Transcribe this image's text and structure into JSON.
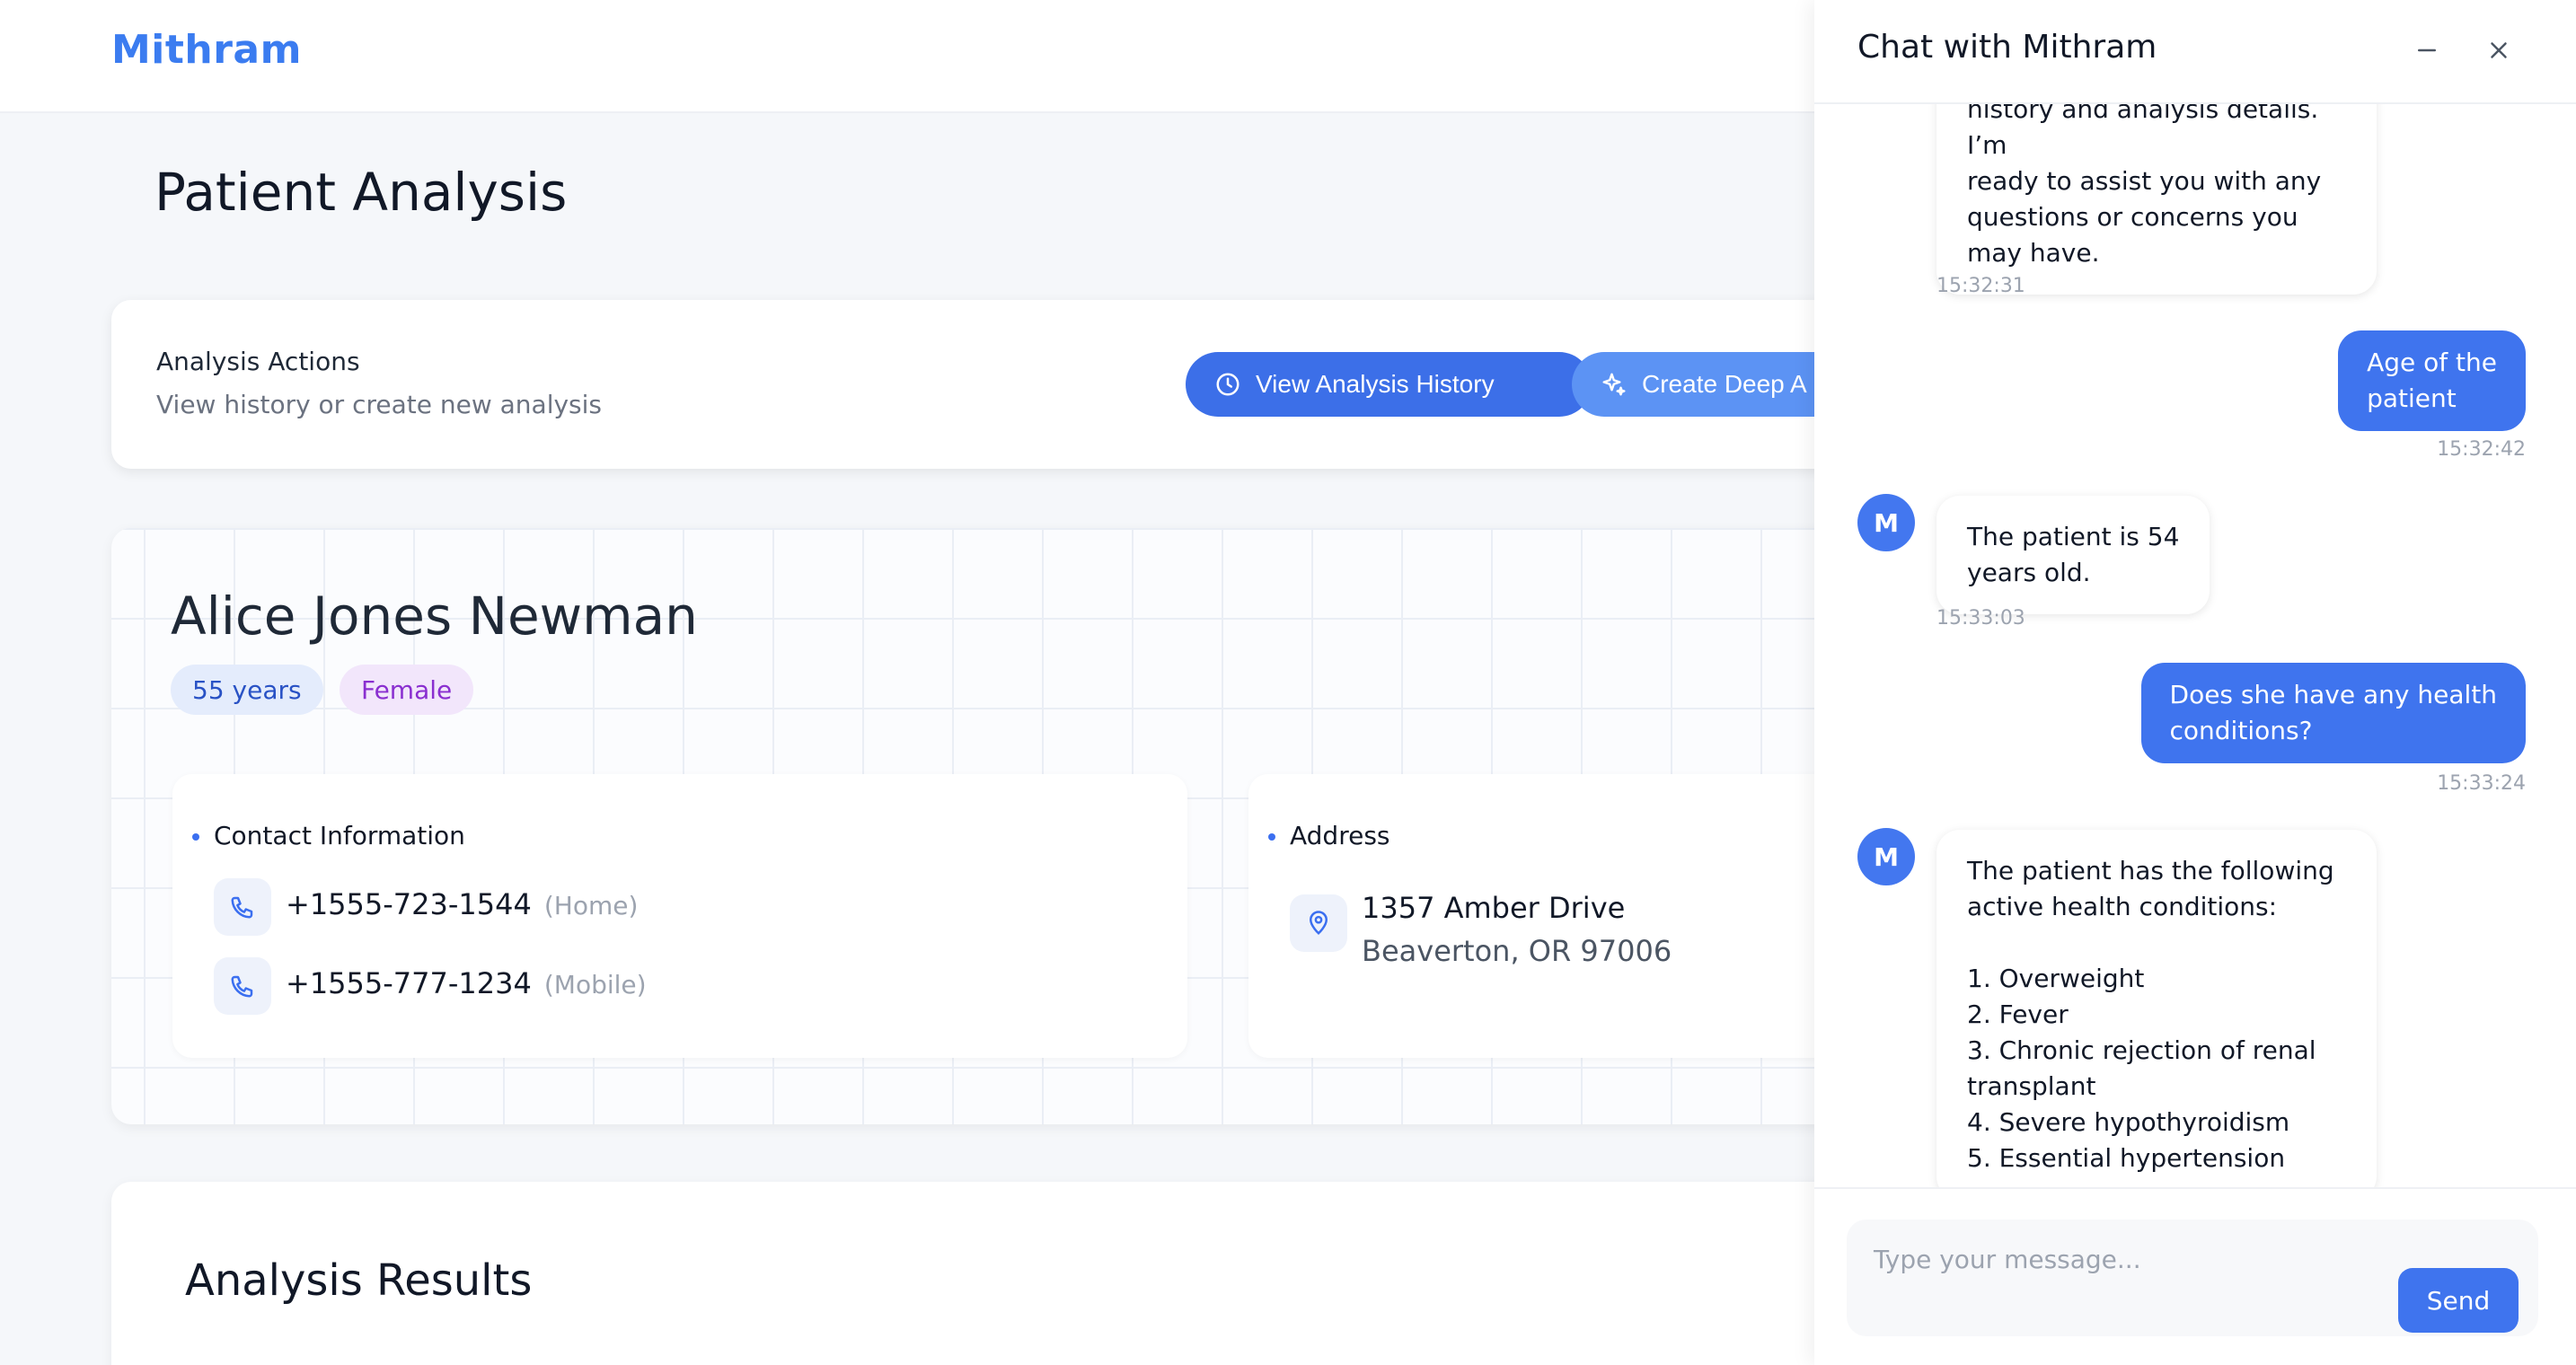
{
  "app": {
    "logo": "Mithram"
  },
  "page": {
    "title": "Patient Analysis"
  },
  "actions": {
    "title": "Analysis Actions",
    "subtitle": "View history or create new analysis",
    "history_label": "View Analysis History",
    "deep_label": "Create Deep A"
  },
  "patient": {
    "name": "Alice Jones Newman",
    "age": "55 years",
    "gender": "Female",
    "contact": {
      "title": "Contact Information",
      "phones": [
        {
          "number": "+1555-723-1544",
          "type": "(Home)"
        },
        {
          "number": "+1555-777-1234",
          "type": "(Mobile)"
        }
      ]
    },
    "address": {
      "title": "Address",
      "line1": "1357 Amber Drive",
      "line2": "Beaverton, OR 97006"
    }
  },
  "results": {
    "title": "Analysis Results"
  },
  "chat": {
    "title": "Chat with Mithram",
    "avatar_letter": "M",
    "messages": [
      {
        "role": "bot",
        "text": "history and analysis details. I’m\nready to assist you with any\nquestions or concerns you\nmay have.",
        "time": "15:32:31"
      },
      {
        "role": "user",
        "text": "Age of the\npatient",
        "time": "15:32:42"
      },
      {
        "role": "bot",
        "text": "The patient is 54\nyears old.",
        "time": "15:33:03"
      },
      {
        "role": "user",
        "text": "Does she have any health\nconditions?",
        "time": "15:33:24"
      },
      {
        "role": "bot",
        "text": "The patient has the following\nactive health conditions:\n\n1. Overweight\n2. Fever\n3. Chronic rejection of renal\ntransplant\n4. Severe hypothyroidism\n5. Essential hypertension",
        "time": ""
      }
    ],
    "input_placeholder": "Type your message...",
    "send_label": "Send"
  },
  "colors": {
    "accent": "#3b6ff0",
    "logo": "#3b7cf0"
  },
  "icons": {
    "history": "clock-icon",
    "deep": "sparkles-icon",
    "phone": "phone-icon",
    "address": "map-pin-icon",
    "minimize": "minimize-icon",
    "close": "close-icon"
  }
}
